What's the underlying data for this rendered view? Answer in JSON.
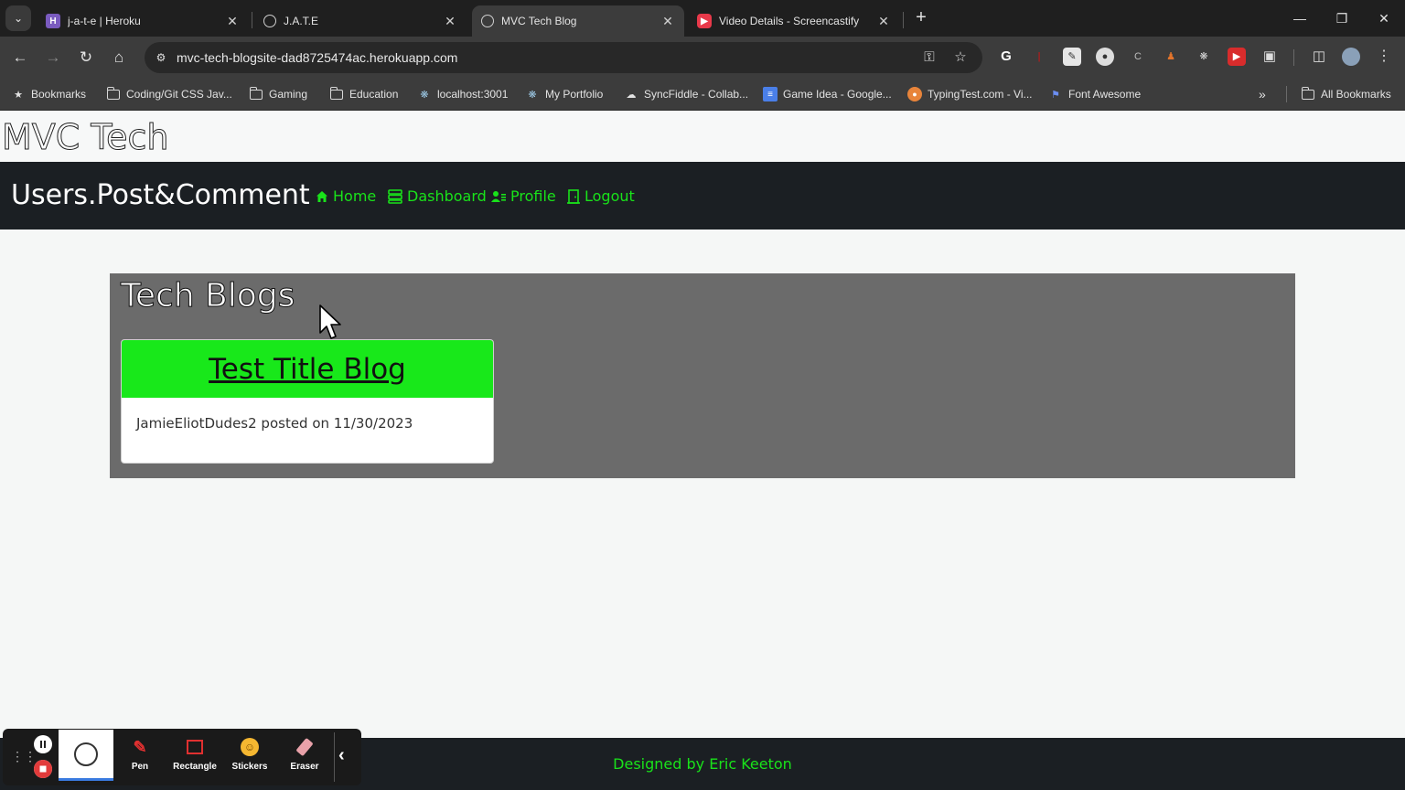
{
  "browser": {
    "tabs": [
      {
        "title": "j-a-t-e | Heroku",
        "favicon": "heroku-icon",
        "active": false
      },
      {
        "title": "J.A.T.E",
        "favicon": "globe-icon",
        "active": false
      },
      {
        "title": "MVC Tech Blog",
        "favicon": "globe-icon",
        "active": true
      },
      {
        "title": "Video Details - Screencastify",
        "favicon": "screencastify-icon",
        "active": false
      }
    ],
    "url": "mvc-tech-blogsite-dad8725474ac.herokuapp.com",
    "bookmarks": [
      {
        "label": "Bookmarks",
        "icon": "star-icon"
      },
      {
        "label": "Coding/Git CSS Jav...",
        "icon": "folder-icon"
      },
      {
        "label": "Gaming",
        "icon": "folder-icon"
      },
      {
        "label": "Education",
        "icon": "folder-icon"
      },
      {
        "label": "localhost:3001",
        "icon": "react-icon"
      },
      {
        "label": "My Portfolio",
        "icon": "react-icon"
      },
      {
        "label": "SyncFiddle - Collab...",
        "icon": "cloud-icon"
      },
      {
        "label": "Game Idea - Google...",
        "icon": "docs-icon"
      },
      {
        "label": "TypingTest.com - Vi...",
        "icon": "typingtest-icon"
      },
      {
        "label": "Font Awesome",
        "icon": "flag-icon"
      }
    ],
    "all_bookmarks_label": "All Bookmarks"
  },
  "site": {
    "brand": "MVC Tech",
    "nav_title": "Users.Post&Comment",
    "nav_links": [
      {
        "label": "Home",
        "icon": "home-icon"
      },
      {
        "label": "Dashboard",
        "icon": "dashboard-icon"
      },
      {
        "label": "Profile",
        "icon": "profile-icon"
      },
      {
        "label": "Logout",
        "icon": "logout-icon"
      }
    ],
    "panel_title": "Tech Blogs",
    "posts": [
      {
        "title": "Test Title Blog",
        "meta": "JamieEliotDudes2 posted on 11/30/2023"
      }
    ],
    "footer": "Designed by Eric Keeton"
  },
  "screencast_toolbar": {
    "tools": [
      {
        "label": "Pen",
        "icon": "pen-icon"
      },
      {
        "label": "Rectangle",
        "icon": "rectangle-icon"
      },
      {
        "label": "Stickers",
        "icon": "sticker-icon"
      },
      {
        "label": "Eraser",
        "icon": "eraser-icon"
      }
    ]
  },
  "colors": {
    "accent_green": "#19e21a",
    "card_header_green": "#18e81a",
    "nav_background": "#1b1f23",
    "panel_gray": "#6b6b6b"
  }
}
